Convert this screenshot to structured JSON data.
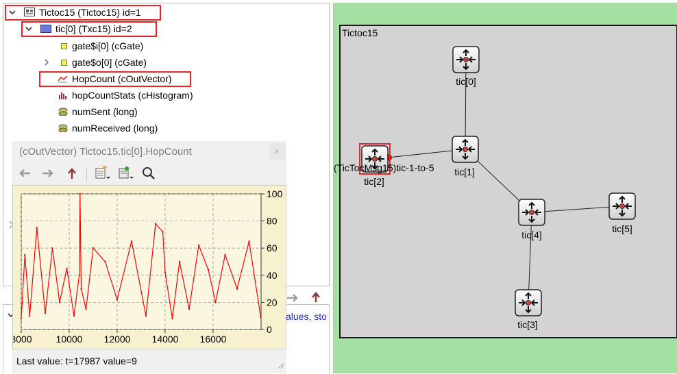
{
  "tree": {
    "items": [
      {
        "label": "Tictoc15 (Tictoc15) id=1"
      },
      {
        "label": "tic[0] (Txc15) id=2"
      },
      {
        "label": "gate$i[0] (cGate)"
      },
      {
        "label": "gate$o[0] (cGate)"
      },
      {
        "label": "HopCount (cOutVector)"
      },
      {
        "label": "hopCountStats (cHistogram)"
      },
      {
        "label": "numSent (long)"
      },
      {
        "label": "numReceived (long)"
      }
    ]
  },
  "bottom_panel": {
    "partial_text": "alues, sto"
  },
  "vector_window": {
    "title": "(cOutVector) Tictoc15.tic[0].HopCount",
    "close_label": "×",
    "status": "Last value: t=17987  value=9",
    "toolbar_icons": [
      "back-arrow-icon",
      "forward-arrow-icon",
      "up-arrow-icon",
      "options-icon",
      "filter-icon",
      "search-icon"
    ]
  },
  "chart_data": {
    "type": "line",
    "title": "",
    "xlabel": "",
    "ylabel": "",
    "xlim": [
      8000,
      18000
    ],
    "ylim": [
      0,
      100
    ],
    "x_ticks": [
      8000,
      10000,
      12000,
      14000,
      16000
    ],
    "y_ticks": [
      0,
      20,
      40,
      60,
      80,
      100
    ],
    "grid": true,
    "series": [
      {
        "color": "#ff0000",
        "x": [
          8000,
          8150,
          8350,
          8650,
          9000,
          9300,
          9600,
          9900,
          10200,
          10420,
          10450,
          10500,
          10700,
          11000,
          11500,
          12000,
          12600,
          13200,
          13600,
          13900,
          14000,
          14300,
          14600,
          15000,
          15400,
          15800,
          16100,
          16500,
          17000,
          17500,
          17987
        ],
        "y": [
          8,
          55,
          10,
          75,
          12,
          60,
          20,
          45,
          10,
          40,
          100,
          30,
          15,
          60,
          50,
          22,
          65,
          10,
          78,
          72,
          42,
          8,
          50,
          15,
          62,
          44,
          20,
          55,
          30,
          65,
          9
        ]
      }
    ]
  },
  "network": {
    "title": "Tictoc15",
    "nodes": [
      {
        "label": "tic[0]"
      },
      {
        "label": "tic[1]"
      },
      {
        "label": "tic[2]"
      },
      {
        "label": "tic[3]"
      },
      {
        "label": "tic[4]"
      },
      {
        "label": "tic[5]"
      }
    ],
    "message_label": "(TicTocMsg15)tic-1-to-5",
    "colors": {
      "highlight": "#e8262a",
      "canvas": "#a3e0a1",
      "box": "#d3d3d3"
    }
  }
}
